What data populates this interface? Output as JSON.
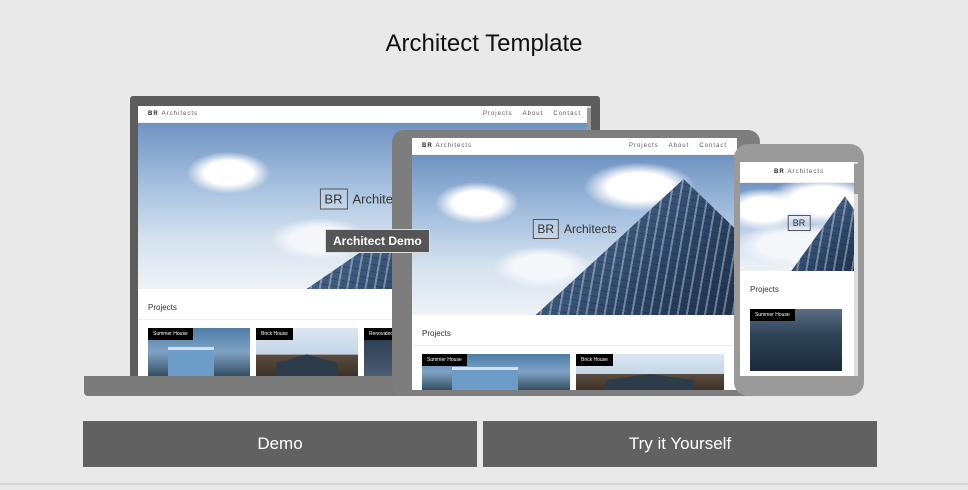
{
  "title": "Architect Template",
  "tooltip": "Architect Demo",
  "buttons": {
    "demo": "Demo",
    "try": "Try it Yourself"
  },
  "site": {
    "brand_mark": "BR",
    "brand_name": "Architects",
    "nav": [
      "Projects",
      "About",
      "Contact"
    ],
    "hero_mark": "BR",
    "hero_name": "Architects",
    "section_title": "Projects",
    "cards": [
      "Summer House",
      "Brick House",
      "Renovated"
    ]
  },
  "colors": {
    "background": "#e9e9e9",
    "button": "#616161",
    "device_frame": "#5d5d5d"
  }
}
